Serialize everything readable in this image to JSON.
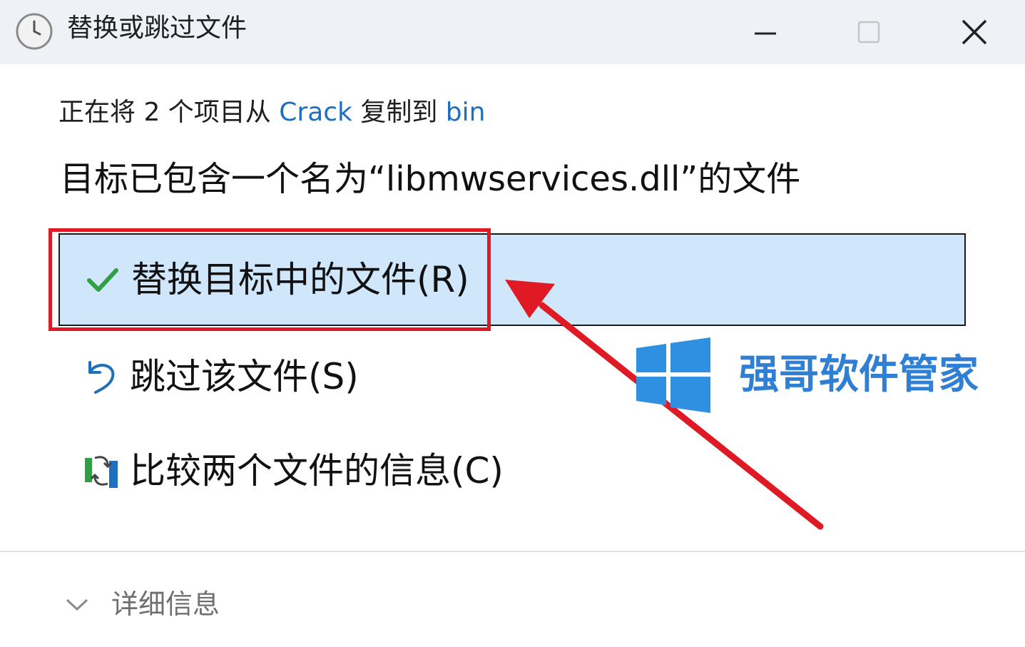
{
  "window": {
    "title": "替换或跳过文件",
    "icon": "clock-icon",
    "controls": [
      "minimize-icon",
      "maximize-icon",
      "close-icon"
    ]
  },
  "copy_status": {
    "prefix": "正在将 2 个项目从 ",
    "source": "Crack",
    "middle": " 复制到 ",
    "destination": "bin"
  },
  "heading": "目标已包含一个名为“libmwservices.dll”的文件",
  "options": [
    {
      "label": "替换目标中的文件(R)",
      "icon": "check-icon",
      "selected": true
    },
    {
      "label": "跳过该文件(S)",
      "icon": "undo-arrow-icon",
      "selected": false
    },
    {
      "label": "比较两个文件的信息(C)",
      "icon": "compare-icon",
      "selected": false
    }
  ],
  "watermark": {
    "text": "强哥软件管家",
    "icon": "windows-logo-icon"
  },
  "details": {
    "label": "详细信息",
    "icon": "chevron-down-icon"
  },
  "colors": {
    "selected_background": "#cfe6fb",
    "annotation_red": "#e01a24",
    "link_blue": "#1f6fbf",
    "watermark_blue": "#2f7fd4"
  }
}
